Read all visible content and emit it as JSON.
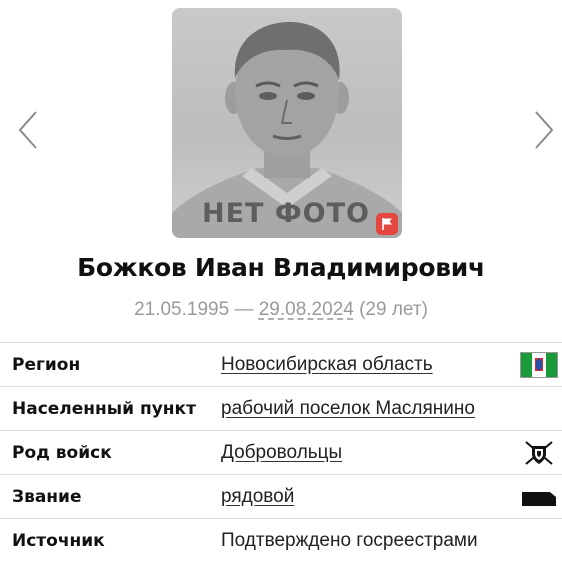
{
  "photo": {
    "placeholder_label": "НЕТ ФОТО",
    "report_icon": "flag-icon"
  },
  "nav": {
    "prev_icon": "chevron-left-icon",
    "next_icon": "chevron-right-icon"
  },
  "person": {
    "name": "Божков Иван Владимирович",
    "birth_date": "21.05.1995",
    "separator": " — ",
    "death_date": "29.08.2024",
    "age": " (29 лет)"
  },
  "info": {
    "rows": [
      {
        "label": "Регион",
        "value": "Новосибирская область",
        "icon": "region-flag-icon"
      },
      {
        "label": "Населенный пункт",
        "value": "рабочий поселок Маслянино"
      },
      {
        "label": "Род войск",
        "value": "Добровольцы",
        "icon": "volunteers-emblem-icon"
      },
      {
        "label": "Звание",
        "value": "рядовой",
        "icon": "rank-insignia-icon"
      },
      {
        "label": "Источник",
        "value": "Подтверждено госреестрами"
      }
    ]
  },
  "colors": {
    "name_text": "#111111",
    "dates_text": "#9a9a9a",
    "report_flag": "#e4473f",
    "divider": "#d9d9d9"
  }
}
